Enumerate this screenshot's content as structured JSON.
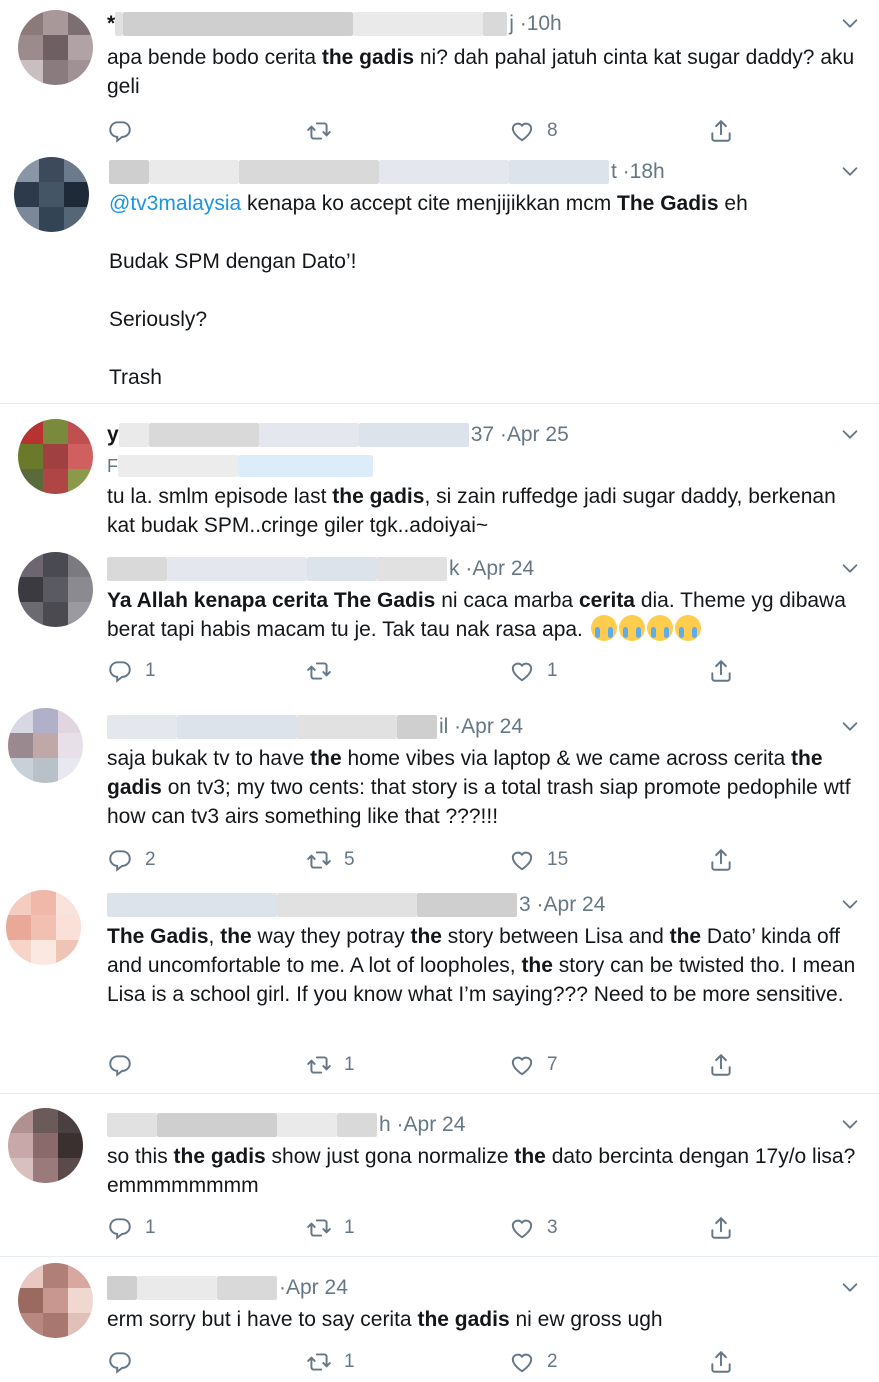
{
  "tweets": [
    {
      "time": "10h",
      "time_prefix": "j · ",
      "header_prefix": "*",
      "reply": null,
      "body_html": "apa bende bodo cerita <b>the gadis</b> ni? dah pahal jatuh cinta kat sugar daddy? aku geli",
      "actions": {
        "reply": "",
        "retweet": "",
        "like": "8"
      }
    },
    {
      "time": "18h",
      "time_prefix": "t · ",
      "reply": null,
      "body_html": "<span class=\"mention\">@tv3malaysia</span> kenapa ko accept cite menjijikkan mcm <b>The Gadis</b> eh\n\nBudak SPM dengan Dato’!\n\nSeriously?\n\nTrash",
      "actions": null
    },
    {
      "time": "Apr 25",
      "time_prefix": "37 · ",
      "header_prefix": "y",
      "reply": "F",
      "body_html": "tu la. smlm episode last <b>the gadis</b>, si zain ruffedge jadi sugar daddy, berkenan kat budak SPM..cringe giler tgk..adoiyai~",
      "actions": null
    },
    {
      "time": "Apr 24",
      "time_prefix": "k · ",
      "reply": null,
      "body_html": "<b>Ya Allah kenapa cerita The Gadis</b> ni caca marba <b>cerita</b> dia. Theme yg dibawa berat tapi habis macam tu je. Tak tau nak rasa apa. ",
      "emoji_count": 4,
      "actions": {
        "reply": "1",
        "retweet": "",
        "like": "1"
      }
    },
    {
      "time": "Apr 24",
      "time_prefix": "il · ",
      "reply": null,
      "body_html": "saja bukak tv to have <b>the</b> home vibes via laptop &amp; we came across cerita <b>the gadis</b> on tv3; my two cents: that story is a total trash siap promote pedophile wtf how can tv3 airs something like that ???!!!",
      "actions": {
        "reply": "2",
        "retweet": "5",
        "like": "15"
      }
    },
    {
      "time": "Apr 24",
      "time_prefix": "3 · ",
      "reply": null,
      "body_html": "<b>The Gadis</b>, <b>the</b> way they potray <b>the</b> story between Lisa and <b>the</b> Dato’ kinda off and uncomfortable to me. A lot of loopholes, <b>the</b> story can be twisted tho. I mean Lisa is a school girl. If you know what I’m saying??? Need to be more sensitive.",
      "actions": {
        "reply": "",
        "retweet": "1",
        "like": "7"
      }
    },
    {
      "time": "Apr 24",
      "time_prefix": "h · ",
      "reply": null,
      "body_html": "so this <b>the gadis</b> show just gona normalize <b>the</b> dato bercinta dengan 17y/o lisa? emmmmmmmm",
      "actions": {
        "reply": "1",
        "retweet": "1",
        "like": "3"
      }
    },
    {
      "time": "Apr 24",
      "time_prefix": "· ",
      "reply": null,
      "body_html": "erm sorry but i have to say cerita <b>the gadis</b> ni ew gross ugh",
      "actions": {
        "reply": "",
        "retweet": "1",
        "like": "2"
      }
    }
  ],
  "icons": {
    "reply": "reply-icon",
    "retweet": "retweet-icon",
    "like": "like-icon",
    "share": "share-icon",
    "menu": "chevron-down-icon",
    "emoji": "loudly-crying-face-emoji"
  },
  "colors": {
    "text": "#14171a",
    "secondary": "#657786",
    "mention": "#1b95e0",
    "separator": "#e6ecf0"
  }
}
